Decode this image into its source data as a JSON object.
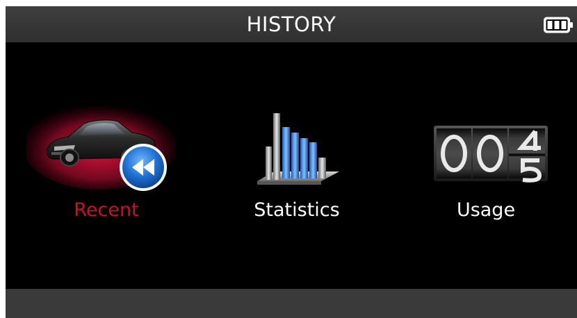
{
  "header": {
    "title": "HISTORY",
    "battery_icon": "battery-full-icon"
  },
  "menu": {
    "items": [
      {
        "label": "Recent",
        "icon": "car-rewind-icon",
        "selected": true
      },
      {
        "label": "Statistics",
        "icon": "bar-chart-icon",
        "selected": false
      },
      {
        "label": "Usage",
        "icon": "odometer-counter-icon",
        "selected": false
      }
    ],
    "usage_counter_digits": "004"
  },
  "colors": {
    "selected_label": "#c8102e",
    "title_bar": "#3a3a3a",
    "background": "#000000",
    "bottom_bar": "#3a3a3a"
  }
}
